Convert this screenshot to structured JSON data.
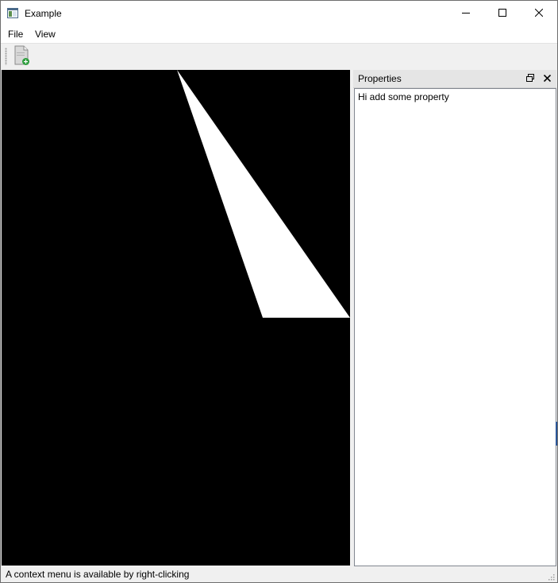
{
  "window": {
    "title": "Example",
    "controls": [
      "minimize-icon",
      "maximize-icon",
      "close-icon"
    ]
  },
  "menubar": {
    "items": [
      {
        "label": "File"
      },
      {
        "label": "View"
      }
    ]
  },
  "toolbar": {
    "buttons": [
      {
        "icon": "new-document-icon",
        "accent": "#2e9e3e"
      }
    ]
  },
  "canvas": {
    "background": "#000000",
    "shape_color": "#ffffff"
  },
  "dock": {
    "title": "Properties",
    "buttons": [
      "float-icon",
      "close-icon"
    ],
    "content_text": "Hi add some property"
  },
  "statusbar": {
    "message": "A context menu is available by right-clicking"
  }
}
